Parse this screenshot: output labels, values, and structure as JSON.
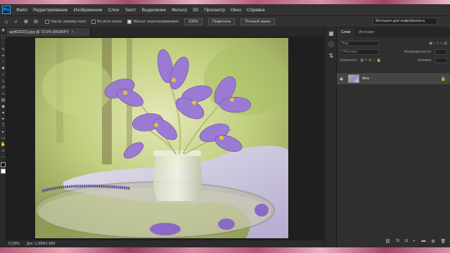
{
  "menubar": {
    "items": [
      "Файл",
      "Редактирование",
      "Изображение",
      "Слои",
      "Текст",
      "Выделение",
      "Фильтр",
      "3D",
      "Просмотр",
      "Окно",
      "Справка"
    ]
  },
  "options": {
    "resize_windows": "Настр. размер окон",
    "all_windows": "Во всех окнах",
    "scrubby_zoom": "Масшт. перетаскиванием",
    "zoom_100": "100%",
    "fit_screen": "Подогнать",
    "fill_screen": "Полный экран",
    "workspace": "Фотошоп для инфобизнеса"
  },
  "document": {
    "tab_title": "ag46332[1].jpg @ 72,9% (RGB/8*)",
    "zoom": "72,89%",
    "doc_size": "Док: 3,38M/3,38M"
  },
  "panels": {
    "tab_layers": "Слои",
    "tab_history": "История",
    "kind_placeholder": "Вид",
    "blend_mode": "Обычные",
    "opacity_label": "Непрозрачность:",
    "lock_label": "Закрепить:",
    "fill_label": "Заливка:",
    "layer_name": "Фон"
  },
  "icons": {
    "visibility": "eye-icon",
    "lock": "lock-icon"
  }
}
